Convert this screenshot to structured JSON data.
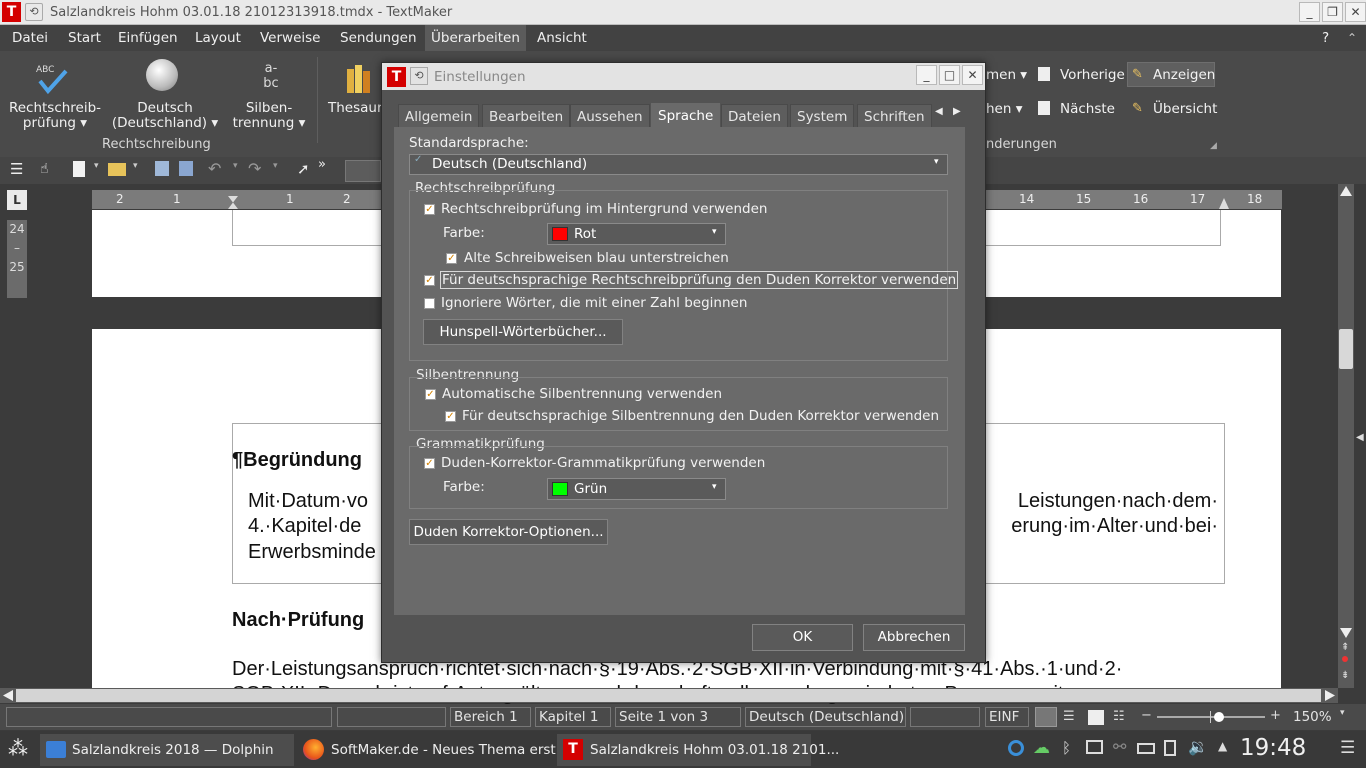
{
  "window": {
    "title": "Salzlandkreis Hohm 03.01.18 21012313918.tmdx - TextMaker"
  },
  "menubar": [
    "Datei",
    "Start",
    "Einfügen",
    "Layout",
    "Verweise",
    "Sendungen",
    "Überarbeiten",
    "Ansicht"
  ],
  "menubar_help": "?",
  "ribbon": {
    "spell_l1": "Rechtschreib-",
    "spell_l2": "prüfung",
    "lang_l1": "Deutsch",
    "lang_l2": "(Deutschland)",
    "hyph_l1": "Silben-",
    "hyph_l2": "trennung",
    "thesaurus": "Thesaurus",
    "group_spell": "Rechtschreibung",
    "comments_frag": "men",
    "prev": "Vorherige",
    "show": "Anzeigen",
    "changes_frag": "hen",
    "next": "Nächste",
    "overview": "Übersicht",
    "group_changes_frag": "nderungen"
  },
  "ruler": {
    "left": [
      "2",
      "1",
      "1",
      "2"
    ],
    "right": [
      "14",
      "15",
      "16",
      "17",
      "18"
    ]
  },
  "side_pages": {
    "a": "24",
    "b": "–",
    "c": "25"
  },
  "document": {
    "heading": "¶Begründung",
    "p1a": "Mit·Datum·vo",
    "p1b": "Leistungen·nach·dem·",
    "p2a": "4.·Kapitel·de",
    "p2b": "erung·im·Alter·und·bei·",
    "p3a": "Erwerbsminde",
    "heading2": "Nach·Prüfung",
    "p4": "Der·Leistungsanspruch·richtet·sich·nach·§·19·Abs.·2·SGB·XII·in·Verbindung·mit·§·41·Abs.·1·und·2·",
    "p5": "SGB·XII.·Danach·ist·auf·Antrag·älteren·und·dauerhaft·voll·erwerbsgeminderten·Personen·mit"
  },
  "dialog": {
    "title": "Einstellungen",
    "tabs": [
      "Allgemein",
      "Bearbeiten",
      "Aussehen",
      "Sprache",
      "Dateien",
      "System",
      "Schriften"
    ],
    "active_tab": "Sprache",
    "std_lang_label": "Standardsprache:",
    "std_lang_value": "Deutsch (Deutschland)",
    "grp_spell": "Rechtschreibprüfung",
    "cb_background": "Rechtschreibprüfung im Hintergrund verwenden",
    "color_label": "Farbe:",
    "color_spell": "Rot",
    "color_spell_hex": "#ff0000",
    "cb_old_spelling": "Alte Schreibweisen blau unterstreichen",
    "cb_duden": "Für deutschsprachige Rechtschreibprüfung den Duden Korrektor verwenden",
    "cb_ignore_numbers": "Ignoriere Wörter, die mit einer Zahl beginnen",
    "btn_hunspell": "Hunspell-Wörterbücher...",
    "grp_hyph": "Silbentrennung",
    "cb_auto_hyph": "Automatische Silbentrennung verwenden",
    "cb_duden_hyph": "Für deutschsprachige Silbentrennung den Duden Korrektor verwenden",
    "grp_grammar": "Grammatikprüfung",
    "cb_grammar": "Duden-Korrektor-Grammatikprüfung verwenden",
    "color_grammar": "Grün",
    "color_grammar_hex": "#00ff00",
    "btn_duden_options": "Duden Korrektor-Optionen...",
    "ok": "OK",
    "cancel": "Abbrechen",
    "checked": {
      "background": true,
      "old_spelling": true,
      "duden": true,
      "ignore_numbers": false,
      "auto_hyph": true,
      "duden_hyph": true,
      "grammar": true
    }
  },
  "status": {
    "area": "Bereich 1",
    "chapter": "Kapitel 1",
    "page": "Seite 1 von 3",
    "language": "Deutsch (Deutschland)",
    "mode": "EINF",
    "zoom": "150%"
  },
  "taskbar": {
    "t1": "Salzlandkreis 2018 — Dolphin",
    "t2": "SoftMaker.de - Neues Thema erst...",
    "t3": "Salzlandkreis Hohm 03.01.18 2101...",
    "clock": "19:48"
  }
}
